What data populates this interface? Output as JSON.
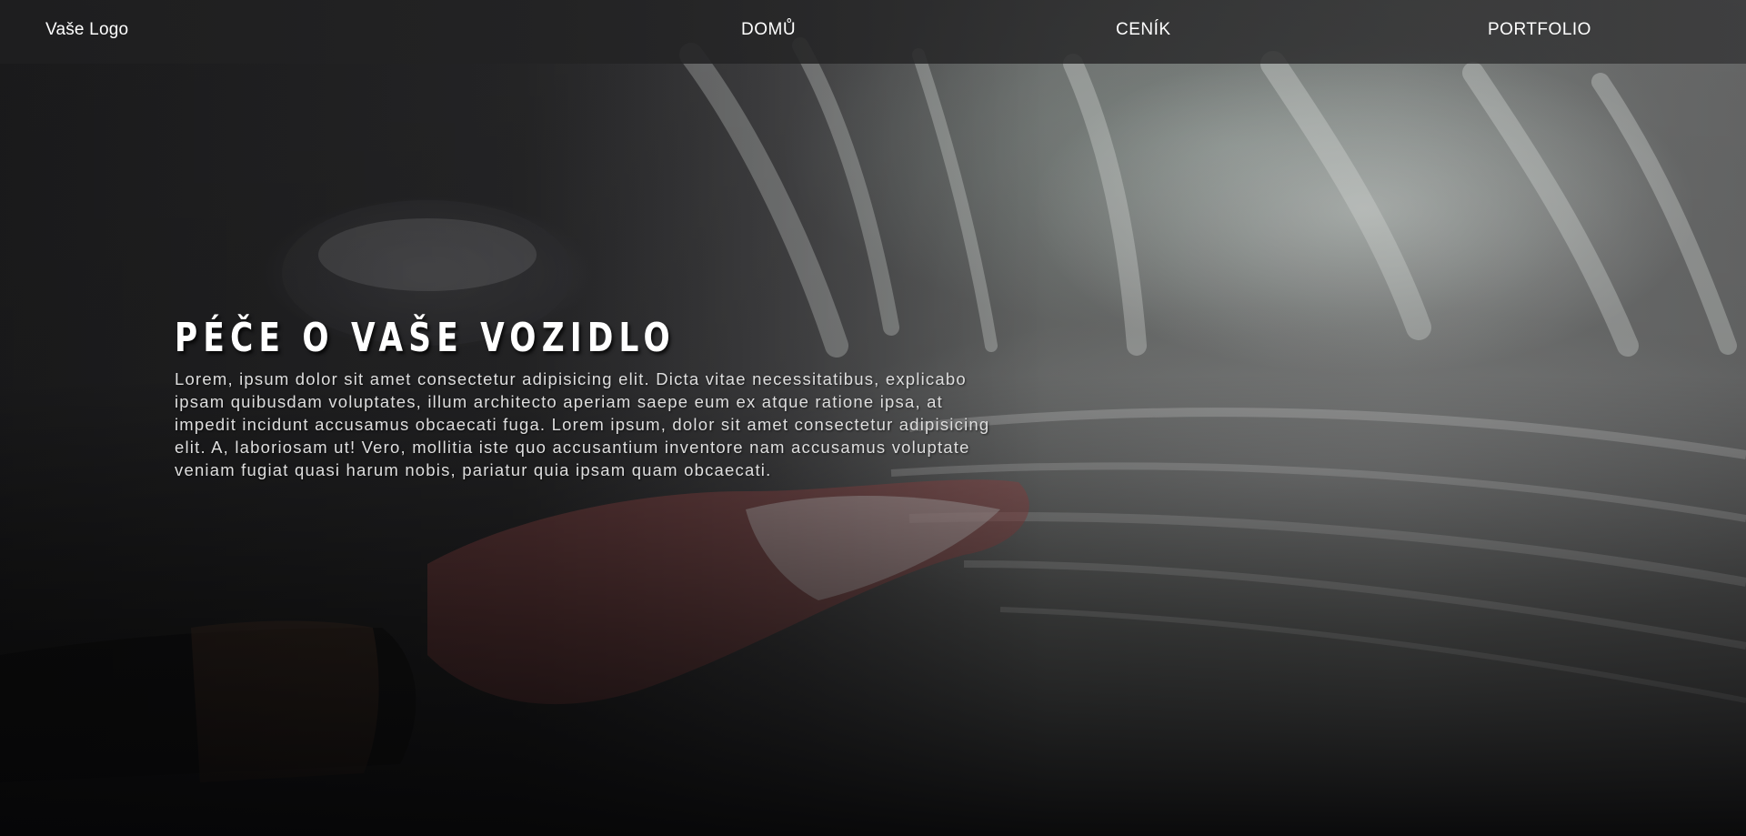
{
  "navbar": {
    "logo": "Vaše Logo",
    "links": [
      {
        "label": "DOMŮ"
      },
      {
        "label": "CENÍK"
      },
      {
        "label": "PORTFOLIO"
      }
    ]
  },
  "hero": {
    "title": "PÉČE O VAŠE VOZIDLO",
    "text": "Lorem, ipsum dolor sit amet consectetur adipisicing elit. Dicta vitae necessitatibus, explicabo ipsam quibusdam voluptates, illum architecto aperiam saepe eum ex atque ratione ipsa, at impedit incidunt accusamus obcaecati fuga. Lorem ipsum, dolor sit amet consectetur adipisicing elit. A, laboriosam ut! Vero, mollitia iste quo accusantium inventore nam accusamus voluptate veniam fugiat quasi harum nobis, pariatur quia ipsam quam obcaecati.",
    "background_image": "car-wash-soap-photo"
  },
  "colors": {
    "nav_text": "#ffffff",
    "title": "#ffffff",
    "body_text": "#dedede"
  }
}
